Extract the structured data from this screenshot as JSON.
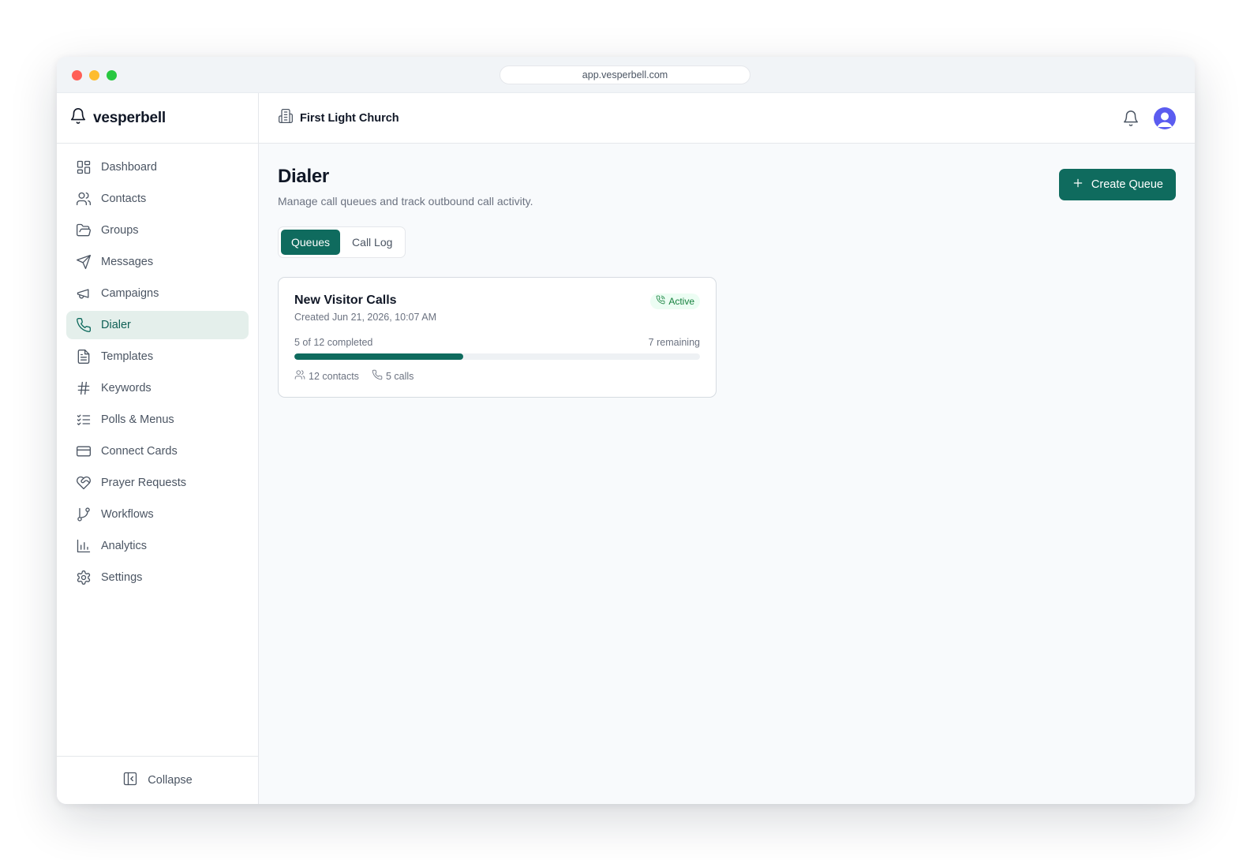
{
  "browser": {
    "url": "app.vesperbell.com"
  },
  "brand": {
    "name": "vesperbell",
    "icon": "bell-icon"
  },
  "sidebar": {
    "items": [
      {
        "label": "Dashboard",
        "icon": "dashboard-icon",
        "active": false
      },
      {
        "label": "Contacts",
        "icon": "users-icon",
        "active": false
      },
      {
        "label": "Groups",
        "icon": "folder-icon",
        "active": false
      },
      {
        "label": "Messages",
        "icon": "send-icon",
        "active": false
      },
      {
        "label": "Campaigns",
        "icon": "megaphone-icon",
        "active": false
      },
      {
        "label": "Dialer",
        "icon": "phone-icon",
        "active": true
      },
      {
        "label": "Templates",
        "icon": "file-text-icon",
        "active": false
      },
      {
        "label": "Keywords",
        "icon": "hash-icon",
        "active": false
      },
      {
        "label": "Polls & Menus",
        "icon": "list-checks-icon",
        "active": false
      },
      {
        "label": "Connect Cards",
        "icon": "credit-card-icon",
        "active": false
      },
      {
        "label": "Prayer Requests",
        "icon": "heart-handshake-icon",
        "active": false
      },
      {
        "label": "Workflows",
        "icon": "git-branch-icon",
        "active": false
      },
      {
        "label": "Analytics",
        "icon": "bar-chart-icon",
        "active": false
      },
      {
        "label": "Settings",
        "icon": "gear-icon",
        "active": false
      }
    ],
    "collapse_label": "Collapse"
  },
  "topbar": {
    "org_name": "First Light Church",
    "org_icon": "building-icon"
  },
  "page": {
    "title": "Dialer",
    "subtitle": "Manage call queues and track outbound call activity.",
    "create_button_label": "Create Queue"
  },
  "tabs": [
    {
      "label": "Queues",
      "active": true
    },
    {
      "label": "Call Log",
      "active": false
    }
  ],
  "queue": {
    "title": "New Visitor Calls",
    "created": "Created Jun 21, 2026, 10:07 AM",
    "status": "Active",
    "progress_label": "5 of 12 completed",
    "remaining_label": "7 remaining",
    "completed": 5,
    "total": 12,
    "contacts_label": "12 contacts",
    "calls_label": "5 calls"
  },
  "colors": {
    "accent": "#0f6b5e",
    "active_nav_bg": "#e4efeb",
    "badge_bg": "#ecfdf3",
    "badge_text": "#15803d",
    "avatar": "#5b5cf0"
  }
}
